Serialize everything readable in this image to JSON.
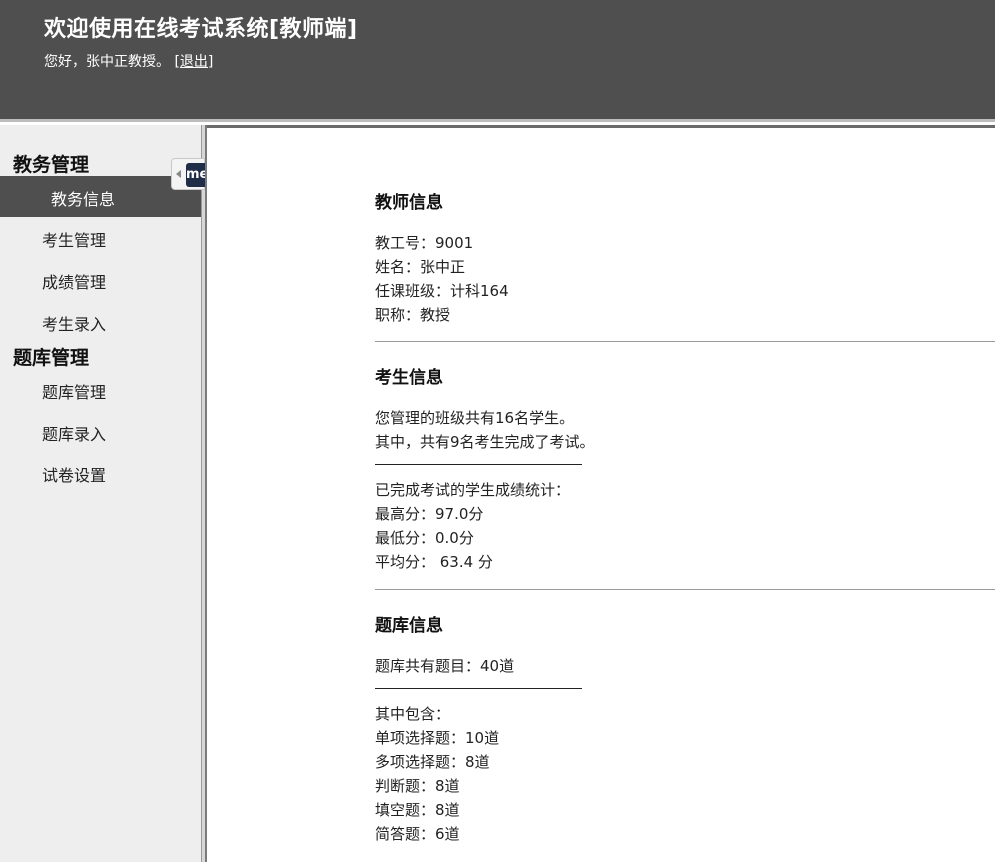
{
  "header": {
    "title": "欢迎使用在线考试系统[教师端]",
    "greeting": "您好，张中正教授。",
    "logout_label": "[退出]"
  },
  "sidebar": {
    "sections": [
      {
        "heading": "教务管理",
        "items": [
          "教务信息",
          "考生管理",
          "成绩管理",
          "考生录入"
        ],
        "active": "教务信息"
      },
      {
        "heading": "题库管理",
        "items": [
          "题库管理",
          "题库录入",
          "试卷设置"
        ]
      }
    ],
    "toggle_badge": "me"
  },
  "main": {
    "teacher": {
      "heading": "教师信息",
      "lines": [
        "教工号：9001",
        "姓名：张中正",
        "任课班级：计科164",
        "职称：教授"
      ]
    },
    "students": {
      "heading": "考生信息",
      "lines": [
        "您管理的班级共有16名学生。",
        "其中，共有9名考生完成了考试。"
      ],
      "stats_title": "已完成考试的学生成绩统计：",
      "stats": [
        "最高分：97.0分",
        "最低分：0.0分",
        "平均分： 63.4 分"
      ]
    },
    "bank": {
      "heading": "题库信息",
      "total": "题库共有题目：40道",
      "breakdown_title": "其中包含：",
      "breakdown": [
        "单项选择题：10道",
        "多项选择题：8道",
        "判断题：8道",
        "填空题：8道",
        "简答题：6道"
      ]
    }
  },
  "colors": {
    "header_bg": "#4f4f4f",
    "sidebar_bg": "#eeeeee",
    "active_bg": "#4f4f4f",
    "badge_bg": "#1f2d46"
  }
}
